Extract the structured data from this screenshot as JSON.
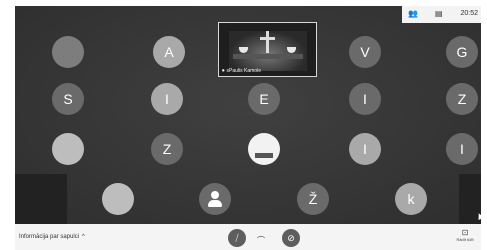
{
  "status_bar": {
    "time": "20:52",
    "people_icon": "people-icon",
    "chat_icon": "chat-icon"
  },
  "presenter": {
    "name": "sPaulis Kamole",
    "mic_icon": "mic-icon"
  },
  "participants": {
    "row1": [
      "",
      "A",
      "V",
      "G"
    ],
    "row2": [
      "S",
      "I",
      "E",
      "I",
      "Z"
    ],
    "row3": [
      "",
      "Z",
      "",
      "I",
      "I"
    ],
    "row4": [
      "",
      "",
      "Ž",
      "k"
    ]
  },
  "bottom_bar": {
    "meeting_details": "Informācija par sapulci",
    "chevron": "^",
    "hangup": "⌒",
    "present_label": "Rādīt tūlīt"
  }
}
